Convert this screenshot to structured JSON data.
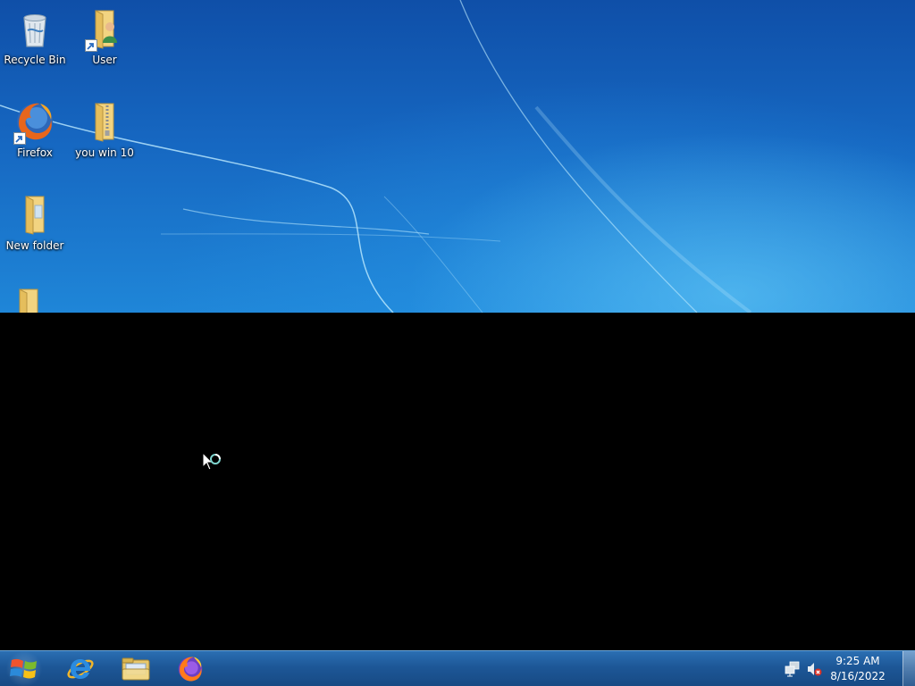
{
  "desktop": {
    "icons": [
      {
        "label": "Recycle Bin",
        "icon": "recycle-bin-icon"
      },
      {
        "label": "User",
        "icon": "user-folder-icon"
      },
      {
        "label": "Firefox",
        "icon": "firefox-icon"
      },
      {
        "label": "you win 10",
        "icon": "zip-folder-icon"
      },
      {
        "label": "New folder",
        "icon": "folder-icon"
      },
      {
        "label": "",
        "icon": "folder-icon"
      }
    ]
  },
  "taskbar": {
    "pinned": [
      {
        "icon": "internet-explorer-icon"
      },
      {
        "icon": "file-explorer-icon"
      },
      {
        "icon": "firefox-icon"
      }
    ],
    "tray": {
      "icons": [
        "network-icon",
        "volume-muted-icon"
      ],
      "time": "9:25 AM",
      "date": "8/16/2022"
    }
  },
  "colors": {
    "wallpaper": "#1667c1",
    "taskbar": "#1d5797",
    "lower_screen": "#000000"
  }
}
